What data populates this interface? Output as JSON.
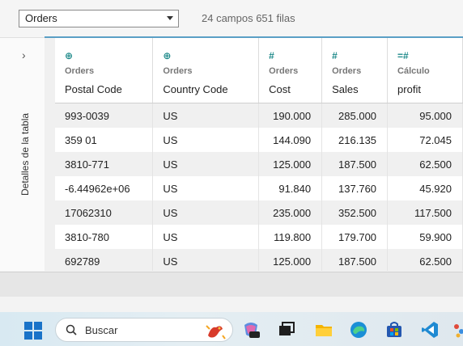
{
  "toolbar": {
    "source_value": "Orders",
    "summary": "24 campos 651 filas"
  },
  "sidepanel": {
    "chevron": "›",
    "label": "Detalles de la tabla"
  },
  "columns": [
    {
      "type_icon": "globe-icon",
      "glyph": "⊕",
      "source": "Orders",
      "name": "Postal Code"
    },
    {
      "type_icon": "globe-icon",
      "glyph": "⊕",
      "source": "Orders",
      "name": "Country Code"
    },
    {
      "type_icon": "number-icon",
      "glyph": "#",
      "source": "Orders",
      "name": "Cost"
    },
    {
      "type_icon": "number-icon",
      "glyph": "#",
      "source": "Orders",
      "name": "Sales"
    },
    {
      "type_icon": "calc-number-icon",
      "glyph": "=#",
      "source": "Cálculo",
      "name": "profit"
    }
  ],
  "rows": [
    [
      "993-0039",
      "US",
      "190.000",
      "285.000",
      "95.000"
    ],
    [
      "359 01",
      "US",
      "144.090",
      "216.135",
      "72.045"
    ],
    [
      "3810-771",
      "US",
      "125.000",
      "187.500",
      "62.500"
    ],
    [
      "-6.44962e+06",
      "US",
      "91.840",
      "137.760",
      "45.920"
    ],
    [
      "17062310",
      "US",
      "235.000",
      "352.500",
      "117.500"
    ],
    [
      "3810-780",
      "US",
      "119.800",
      "179.700",
      "59.900"
    ],
    [
      "692789",
      "US",
      "125.000",
      "187.500",
      "62.500"
    ]
  ],
  "taskbar": {
    "search_placeholder": "Buscar"
  },
  "colors": {
    "accent_strip": "#5a9fc5",
    "type_icon": "#1e8a8a"
  }
}
